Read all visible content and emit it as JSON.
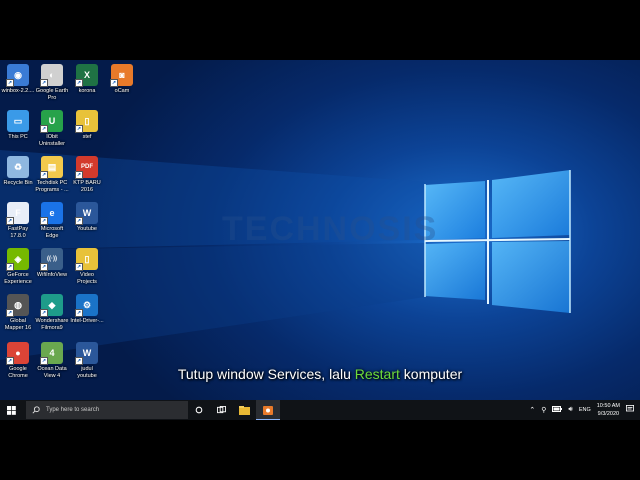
{
  "desktop": {
    "icons": [
      {
        "label": "winbox-2.2....",
        "icon": "winbox-icon",
        "color": "#3a7bd5"
      },
      {
        "label": "Google Earth\nPro",
        "icon": "google-earth-icon",
        "color": "#d0d0d0"
      },
      {
        "label": "korona",
        "icon": "excel-icon",
        "color": "#1f7244"
      },
      {
        "label": "oCam",
        "icon": "ocam-icon",
        "color": "#e87a2a"
      },
      {
        "label": "This PC",
        "icon": "this-pc-icon",
        "color": "#3a9ae8"
      },
      {
        "label": "IObit\nUninstaller",
        "icon": "iobit-uninstaller-icon",
        "color": "#27a24a"
      },
      {
        "label": "stef",
        "icon": "file-icon",
        "color": "#e8c23a"
      },
      {
        "label": "Recycle Bin",
        "icon": "recycle-bin-icon",
        "color": "#8fb8e0"
      },
      {
        "label": "Techdisk PC\nPrograms - ...",
        "icon": "folder-icon",
        "color": "#f2c94c"
      },
      {
        "label": "KTP BARU\n2016",
        "icon": "pdf-icon",
        "color": "#d33a2c"
      },
      {
        "label": "FastPay\n17.8.0",
        "icon": "fastpay-icon",
        "color": "#e8eef8"
      },
      {
        "label": "Microsoft\nEdge",
        "icon": "edge-icon",
        "color": "#1a73e8"
      },
      {
        "label": "Youtube",
        "icon": "word-icon",
        "color": "#2b579a"
      },
      {
        "label": "GeForce\nExperience",
        "icon": "geforce-icon",
        "color": "#76b900"
      },
      {
        "label": "WifiInfoView",
        "icon": "wifi-info-icon",
        "color": "#3a5f8a"
      },
      {
        "label": "Video\nProjects",
        "icon": "file-icon",
        "color": "#e8c23a"
      },
      {
        "label": "Global\nMapper 16",
        "icon": "global-mapper-icon",
        "color": "#555555"
      },
      {
        "label": "Wondershare\nFilmora9",
        "icon": "filmora-icon",
        "color": "#1e9c8a"
      },
      {
        "label": "Intel-Driver-...",
        "icon": "intel-driver-icon",
        "color": "#1a73c8"
      },
      {
        "label": "Google\nChrome",
        "icon": "chrome-icon",
        "color": "#db4437"
      },
      {
        "label": "Ocean Data\nView 4",
        "icon": "ocean-data-view-icon",
        "color": "#6aa84f"
      },
      {
        "label": "judul\nyoutube",
        "icon": "word-icon",
        "color": "#2b579a"
      }
    ]
  },
  "subtitle": {
    "before": "Tutup window Services, lalu ",
    "highlight": "Restart",
    "after": " komputer"
  },
  "watermark": "TECHNOSIS",
  "taskbar": {
    "search_placeholder": "Type here to search",
    "language": "ENG",
    "time": "10:50 AM",
    "date": "9/3/2020"
  }
}
